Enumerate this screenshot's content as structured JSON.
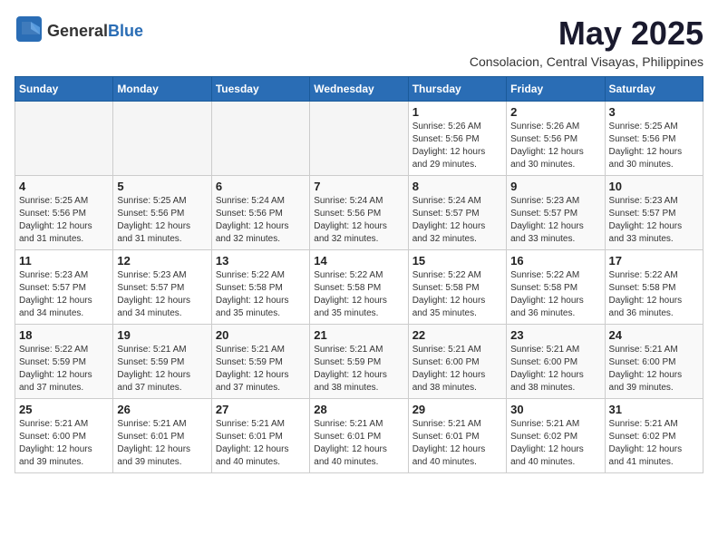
{
  "logo": {
    "general": "General",
    "blue": "Blue"
  },
  "header": {
    "month": "May 2025",
    "location": "Consolacion, Central Visayas, Philippines"
  },
  "weekdays": [
    "Sunday",
    "Monday",
    "Tuesday",
    "Wednesday",
    "Thursday",
    "Friday",
    "Saturday"
  ],
  "weeks": [
    [
      {
        "day": "",
        "info": ""
      },
      {
        "day": "",
        "info": ""
      },
      {
        "day": "",
        "info": ""
      },
      {
        "day": "",
        "info": ""
      },
      {
        "day": "1",
        "info": "Sunrise: 5:26 AM\nSunset: 5:56 PM\nDaylight: 12 hours and 29 minutes."
      },
      {
        "day": "2",
        "info": "Sunrise: 5:26 AM\nSunset: 5:56 PM\nDaylight: 12 hours and 30 minutes."
      },
      {
        "day": "3",
        "info": "Sunrise: 5:25 AM\nSunset: 5:56 PM\nDaylight: 12 hours and 30 minutes."
      }
    ],
    [
      {
        "day": "4",
        "info": "Sunrise: 5:25 AM\nSunset: 5:56 PM\nDaylight: 12 hours and 31 minutes."
      },
      {
        "day": "5",
        "info": "Sunrise: 5:25 AM\nSunset: 5:56 PM\nDaylight: 12 hours and 31 minutes."
      },
      {
        "day": "6",
        "info": "Sunrise: 5:24 AM\nSunset: 5:56 PM\nDaylight: 12 hours and 32 minutes."
      },
      {
        "day": "7",
        "info": "Sunrise: 5:24 AM\nSunset: 5:56 PM\nDaylight: 12 hours and 32 minutes."
      },
      {
        "day": "8",
        "info": "Sunrise: 5:24 AM\nSunset: 5:57 PM\nDaylight: 12 hours and 32 minutes."
      },
      {
        "day": "9",
        "info": "Sunrise: 5:23 AM\nSunset: 5:57 PM\nDaylight: 12 hours and 33 minutes."
      },
      {
        "day": "10",
        "info": "Sunrise: 5:23 AM\nSunset: 5:57 PM\nDaylight: 12 hours and 33 minutes."
      }
    ],
    [
      {
        "day": "11",
        "info": "Sunrise: 5:23 AM\nSunset: 5:57 PM\nDaylight: 12 hours and 34 minutes."
      },
      {
        "day": "12",
        "info": "Sunrise: 5:23 AM\nSunset: 5:57 PM\nDaylight: 12 hours and 34 minutes."
      },
      {
        "day": "13",
        "info": "Sunrise: 5:22 AM\nSunset: 5:58 PM\nDaylight: 12 hours and 35 minutes."
      },
      {
        "day": "14",
        "info": "Sunrise: 5:22 AM\nSunset: 5:58 PM\nDaylight: 12 hours and 35 minutes."
      },
      {
        "day": "15",
        "info": "Sunrise: 5:22 AM\nSunset: 5:58 PM\nDaylight: 12 hours and 35 minutes."
      },
      {
        "day": "16",
        "info": "Sunrise: 5:22 AM\nSunset: 5:58 PM\nDaylight: 12 hours and 36 minutes."
      },
      {
        "day": "17",
        "info": "Sunrise: 5:22 AM\nSunset: 5:58 PM\nDaylight: 12 hours and 36 minutes."
      }
    ],
    [
      {
        "day": "18",
        "info": "Sunrise: 5:22 AM\nSunset: 5:59 PM\nDaylight: 12 hours and 37 minutes."
      },
      {
        "day": "19",
        "info": "Sunrise: 5:21 AM\nSunset: 5:59 PM\nDaylight: 12 hours and 37 minutes."
      },
      {
        "day": "20",
        "info": "Sunrise: 5:21 AM\nSunset: 5:59 PM\nDaylight: 12 hours and 37 minutes."
      },
      {
        "day": "21",
        "info": "Sunrise: 5:21 AM\nSunset: 5:59 PM\nDaylight: 12 hours and 38 minutes."
      },
      {
        "day": "22",
        "info": "Sunrise: 5:21 AM\nSunset: 6:00 PM\nDaylight: 12 hours and 38 minutes."
      },
      {
        "day": "23",
        "info": "Sunrise: 5:21 AM\nSunset: 6:00 PM\nDaylight: 12 hours and 38 minutes."
      },
      {
        "day": "24",
        "info": "Sunrise: 5:21 AM\nSunset: 6:00 PM\nDaylight: 12 hours and 39 minutes."
      }
    ],
    [
      {
        "day": "25",
        "info": "Sunrise: 5:21 AM\nSunset: 6:00 PM\nDaylight: 12 hours and 39 minutes."
      },
      {
        "day": "26",
        "info": "Sunrise: 5:21 AM\nSunset: 6:01 PM\nDaylight: 12 hours and 39 minutes."
      },
      {
        "day": "27",
        "info": "Sunrise: 5:21 AM\nSunset: 6:01 PM\nDaylight: 12 hours and 40 minutes."
      },
      {
        "day": "28",
        "info": "Sunrise: 5:21 AM\nSunset: 6:01 PM\nDaylight: 12 hours and 40 minutes."
      },
      {
        "day": "29",
        "info": "Sunrise: 5:21 AM\nSunset: 6:01 PM\nDaylight: 12 hours and 40 minutes."
      },
      {
        "day": "30",
        "info": "Sunrise: 5:21 AM\nSunset: 6:02 PM\nDaylight: 12 hours and 40 minutes."
      },
      {
        "day": "31",
        "info": "Sunrise: 5:21 AM\nSunset: 6:02 PM\nDaylight: 12 hours and 41 minutes."
      }
    ]
  ]
}
